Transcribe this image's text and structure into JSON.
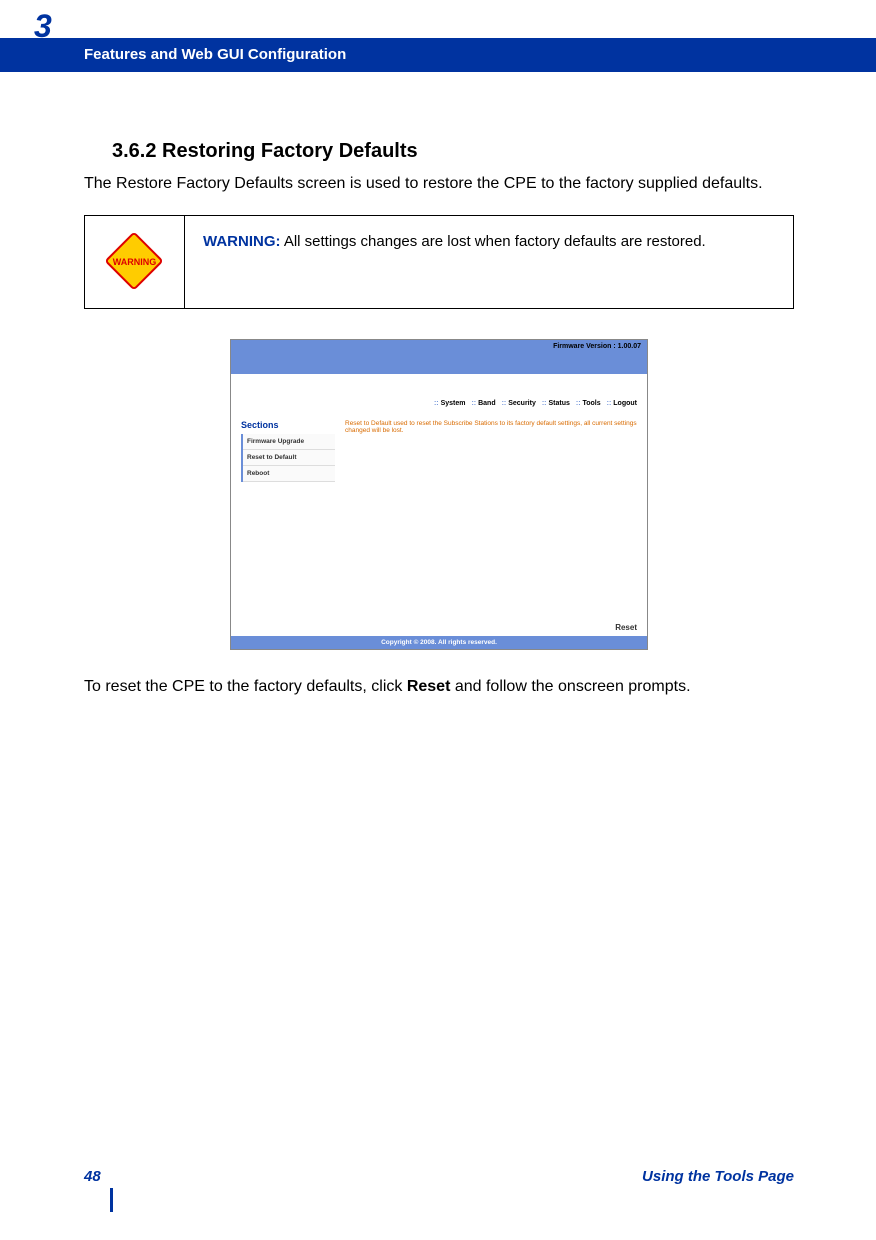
{
  "chapter": {
    "number": "3",
    "title": "Features and Web GUI Configuration"
  },
  "section": {
    "heading": "3.6.2 Restoring Factory Defaults",
    "intro": "The Restore Factory Defaults screen is used to restore the CPE to the factory supplied defaults."
  },
  "warning": {
    "icon_label": "WARNING",
    "label": "WARNING:",
    "text": " All settings changes are lost when factory defaults are restored."
  },
  "screenshot": {
    "firmware_label": "Firmware Version : 1.00.07",
    "nav": {
      "system": "System",
      "band": "Band",
      "security": "Security",
      "status": "Status",
      "tools": "Tools",
      "logout": "Logout"
    },
    "sidebar": {
      "title": "Sections",
      "items": [
        "Firmware Upgrade",
        "Reset to Default",
        "Reboot"
      ]
    },
    "description": "Reset to Default used to reset the Subscribe Stations to its factory default settings, all current settings changed will be lost.",
    "reset_button": "Reset",
    "copyright": "Copyright © 2008.  All rights reserved."
  },
  "para2_pre": "To reset the CPE to the factory defaults, click ",
  "para2_bold": "Reset",
  "para2_post": " and follow the onscreen prompts.",
  "footer": {
    "page": "48",
    "label": "Using the Tools Page"
  }
}
